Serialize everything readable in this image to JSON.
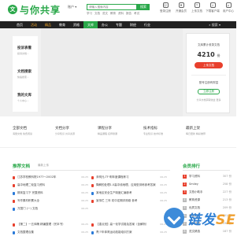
{
  "logo": {
    "badge": "文",
    "text": "与你共享"
  },
  "search": {
    "type_label": "账户 ▾",
    "placeholder": "请输入搜索内容",
    "button": "搜索",
    "hot_words": [
      "学习",
      "文档",
      "范文",
      "教育",
      "资料",
      "报告",
      "考试"
    ]
  },
  "top_icons": [
    {
      "icon": "user-icon",
      "symbol": "☺",
      "label": "登录注册"
    },
    {
      "icon": "vip-icon",
      "symbol": "♦",
      "label": "开通会员"
    },
    {
      "icon": "upload-icon",
      "symbol": "↑",
      "label": "上传文档"
    },
    {
      "icon": "download-icon",
      "symbol": "↓",
      "label": "下载客户端"
    },
    {
      "icon": "home-icon",
      "symbol": "⌂",
      "label": "用户中心"
    }
  ],
  "nav": {
    "items": [
      {
        "label": "首页",
        "style": ""
      },
      {
        "label": "活动",
        "style": "orange"
      },
      {
        "label": "精品",
        "style": "orange"
      },
      {
        "label": "教育",
        "style": ""
      },
      {
        "label": "资格",
        "style": ""
      },
      {
        "label": "文库",
        "style": "active"
      },
      {
        "label": "办公",
        "style": ""
      },
      {
        "label": "专题",
        "style": ""
      },
      {
        "label": "财经",
        "style": ""
      },
      {
        "label": "行业",
        "style": ""
      }
    ],
    "right": "⌕ 搜索 ▾"
  },
  "side_menu": [
    {
      "title": "投诉表看",
      "sub": "投诉文档 ›"
    },
    {
      "title": "文档搜索",
      "sub": "快速搜索 ›"
    },
    {
      "title": "我的文库",
      "sub": "个人中心 ›"
    }
  ],
  "login_card": {
    "title": "文库累计收录文档",
    "count": "4210",
    "unit": "份",
    "button": "上传文档",
    "register_text": "登号注册有财富",
    "button2": "立即注册",
    "note": "分享文档获取收益 更多"
  },
  "categories": [
    {
      "title": "全部文档",
      "sub": "海量文档 免费阅读"
    },
    {
      "title": "文档分享",
      "sub": "分享知识 共享资源"
    },
    {
      "title": "课程分享",
      "sub": "精品课程 名师授课"
    },
    {
      "title": "技术指标",
      "sub": "专业知识 技术标准"
    },
    {
      "title": "最新上架",
      "sub": "每日更新 精彩推荐"
    }
  ],
  "recommended": {
    "title": "推荐文档",
    "subtitle": "最新上传",
    "col1": [
      {
        "text": "江苏学校教科院1977～2002年",
        "date": "06-25",
        "color": "#e8402d"
      },
      {
        "text": "高中地理二轮复习资料",
        "date": "06-25",
        "color": "#e8402d"
      },
      {
        "text": "期末复习下 完整资料",
        "date": "06-25",
        "color": "#2a7ad8"
      },
      {
        "text": "写作素材积累大全",
        "date": "06-25",
        "color": "#e8402d"
      },
      {
        "text": "万国门 (一) 文档",
        "date": "06-25",
        "color": "#2a7ad8"
      },
      {
        "text": "",
        "date": "",
        "color": ""
      },
      {
        "text": "【第二】一五体魄 精编整理（完本书）",
        "date": "06-25",
        "color": "#e8402d"
      },
      {
        "text": "文档整理合集",
        "date": "06-25",
        "color": "#2a7ad8"
      },
      {
        "text": "食品检验工作计划报告参考资料",
        "date": "06-25",
        "color": "#e8402d"
      }
    ],
    "col2": [
      {
        "text": "未明元-TF·明年度课程练习",
        "date": "06-25",
        "color": "#e8402d"
      },
      {
        "text": "降解的处理1.0高中线地理，应用型训练参考答案",
        "date": "06-25",
        "color": "#e8402d"
      },
      {
        "text": "某地区安全生产制度汇编参考",
        "date": "06-25",
        "color": "#2a7ad8"
      },
      {
        "text": "宣传栏 三年 初中定期评测卷 参考",
        "date": "06-25",
        "color": "#e8402d"
      },
      {
        "text": "",
        "date": "",
        "color": ""
      },
      {
        "text": "",
        "date": "",
        "color": ""
      },
      {
        "text": "【重点班】高一化学试卷及答案（含解析）",
        "date": "06-25",
        "color": "#e8402d"
      },
      {
        "text": "青少年体育运动技能培训方案",
        "date": "06-25",
        "color": "#2a7ad8"
      },
      {
        "text": "福建省泉州市中考语文模拟试卷2017",
        "date": "06-25",
        "color": "#e8402d"
      }
    ]
  },
  "ranking": {
    "title": "会员排行",
    "members": [
      {
        "num": "1",
        "name": "学习资料",
        "value": "307 份",
        "top": true
      },
      {
        "num": "2",
        "name": "Smiley",
        "value": "258 份",
        "top": true
      },
      {
        "num": "3",
        "name": "文档小助手",
        "value": "227 份",
        "top": true
      },
      {
        "num": "4",
        "name": "教育资源",
        "value": "213 份",
        "top": false
      },
      {
        "num": "5",
        "name": "优质文档",
        "value": "209 份",
        "top": false
      },
      {
        "num": "6",
        "name": "考试达人",
        "value": "201 份",
        "top": false
      },
      {
        "num": "7",
        "name": "资料分享",
        "value": "196 份",
        "top": false
      },
      {
        "num": "8",
        "name": "范文精选",
        "value": "187 份",
        "top": false
      }
    ]
  },
  "watermark": {
    "text": "链发",
    "seo": "SEO"
  }
}
